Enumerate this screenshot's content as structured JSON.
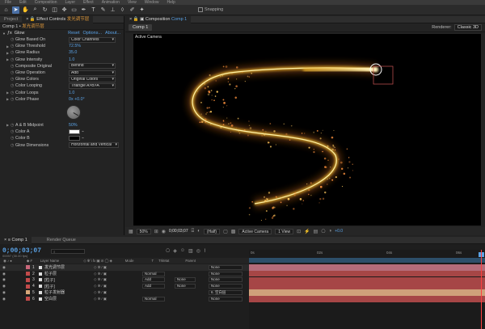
{
  "menu": [
    "File",
    "Edit",
    "Composition",
    "Layer",
    "Effect",
    "Animation",
    "View",
    "Window",
    "Help"
  ],
  "toolbar": {
    "snapping": "Snapping"
  },
  "left": {
    "tab_project": "Project",
    "tab_ec": "Effect Controls",
    "tab_ec_layer": "发光调节层",
    "ec_header_comp": "Comp 1",
    "ec_header_layer": "发光调节层",
    "effect_name": "Glow",
    "links": [
      "Reset",
      "Options...",
      "About..."
    ],
    "params": [
      {
        "name": "Glow Based On",
        "value": "Color Channels",
        "kind": "dd"
      },
      {
        "name": "Glow Threshold",
        "value": "72.5%",
        "kind": "val"
      },
      {
        "name": "Glow Radius",
        "value": "35.0",
        "kind": "val"
      },
      {
        "name": "Glow Intensity",
        "value": "1.0",
        "kind": "val"
      },
      {
        "name": "Composite Original",
        "value": "Behind",
        "kind": "dd"
      },
      {
        "name": "Glow Operation",
        "value": "Add",
        "kind": "dd"
      },
      {
        "name": "Glow Colors",
        "value": "Original Colors",
        "kind": "dd"
      },
      {
        "name": "Color Looping",
        "value": "Triangle A>B>A",
        "kind": "dd"
      },
      {
        "name": "Color Loops",
        "value": "1.0",
        "kind": "val"
      },
      {
        "name": "Color Phase",
        "value": "0x +0.0°",
        "kind": "val"
      }
    ],
    "ab_midpoint": {
      "name": "A & B Midpoint",
      "value": "50%"
    },
    "color_a": "Color A",
    "color_b": "Color B",
    "glow_dimensions": {
      "name": "Glow Dimensions",
      "value": "Horizontal and Vertical"
    }
  },
  "comp": {
    "tab_label": "Composition",
    "tab_comp": "Comp 1",
    "sub_tab": "Comp 1",
    "renderer_label": "Renderer:",
    "renderer_value": "Classic 3D",
    "camera_label": "Active Camera",
    "footer": {
      "zoom": "50%",
      "timecode": "0;00;03;07",
      "resolution": "(Half)",
      "camera": "Active Camera",
      "view": "1 View",
      "exposure": "+0.0"
    }
  },
  "timeline": {
    "tab_comp": "Comp 1",
    "tab_rq": "Render Queue",
    "timecode": "0;00;03;07",
    "fps": "00097 (30.00 fps)",
    "search_placeholder": "",
    "headers": {
      "layer_name": "Layer Name",
      "mode": "Mode",
      "t": "T",
      "trkmat": "TrkMat",
      "parent": "Parent"
    },
    "layers": [
      {
        "num": "1",
        "name": "发光调节层",
        "color": "#c9677a",
        "mode": "",
        "trkmat": "",
        "parent": "None",
        "bar": "#b56c7a"
      },
      {
        "num": "2",
        "name": "粒子层",
        "color": "#c14a4a",
        "mode": "Normal",
        "trkmat": "",
        "parent": "None",
        "bar": "#a64646"
      },
      {
        "num": "3",
        "name": "[粒子]",
        "color": "#c14a4a",
        "mode": "Add",
        "trkmat": "None",
        "parent": "None",
        "bar": "#a64646"
      },
      {
        "num": "4",
        "name": "[粒子]",
        "color": "#c14a4a",
        "mode": "Add",
        "trkmat": "None",
        "parent": "None",
        "bar": "#a64646"
      },
      {
        "num": "5",
        "name": "粒子发射器",
        "color": "#d8a77a",
        "mode": "",
        "trkmat": "",
        "parent": "6. 空白层",
        "bar": "#cfa17a"
      },
      {
        "num": "6",
        "name": "空白层",
        "color": "#c14a4a",
        "mode": "Normal",
        "trkmat": "",
        "parent": "None",
        "bar": "#a64646"
      }
    ],
    "ruler": [
      "0s",
      "02s",
      "04s",
      "06s"
    ]
  },
  "colors": {
    "accent": "#5aa2e6",
    "glow_core": "#fff2a6",
    "glow_mid": "#f3b62a",
    "glow_outer": "#c0621a"
  }
}
